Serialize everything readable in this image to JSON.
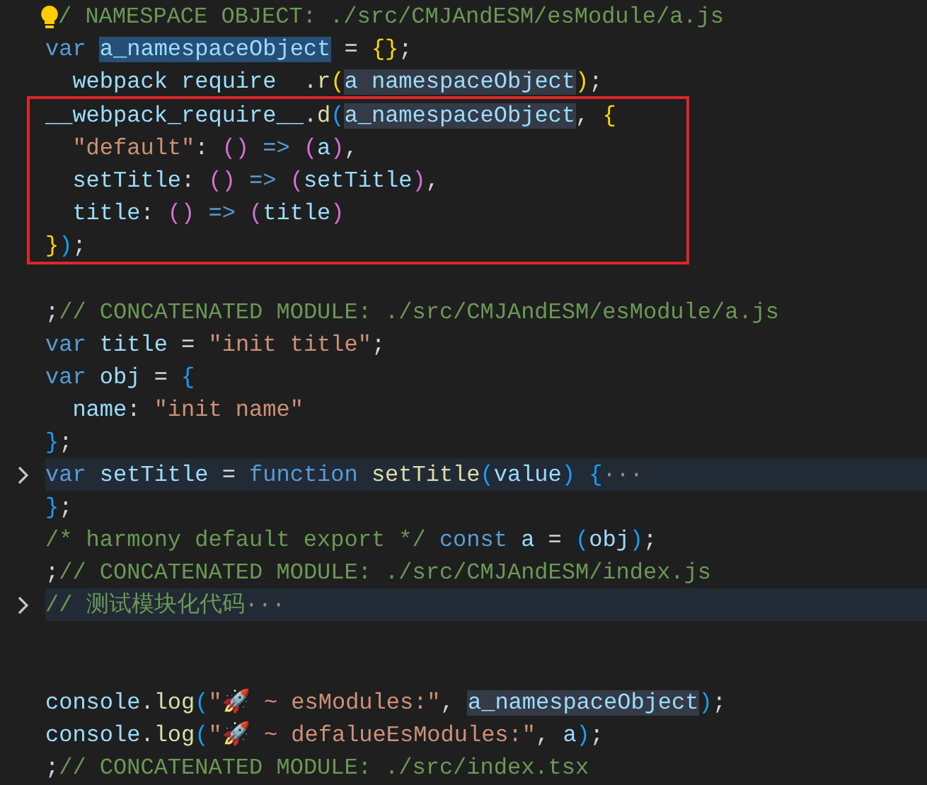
{
  "editor": {
    "lines": [
      {
        "lightbulb": true,
        "tokens": [
          {
            "kind": "comment",
            "text": "/ NAMESPACE OBJECT: ./src/CMJAndESM/esModule/a.js"
          }
        ]
      },
      {
        "tokens": [
          {
            "kind": "keyword",
            "text": "var "
          },
          {
            "kind": "selected",
            "text": "a_namespaceObject"
          },
          {
            "kind": "punct",
            "text": " = "
          },
          {
            "kind": "bracket1",
            "text": "{}"
          },
          {
            "kind": "punct",
            "text": ";"
          }
        ]
      },
      {
        "tokens": [
          {
            "kind": "variable",
            "text": "  webpack require  "
          },
          {
            "kind": "punct",
            "text": "."
          },
          {
            "kind": "function",
            "text": "r"
          },
          {
            "kind": "bracket1",
            "text": "("
          },
          {
            "kind": "reference",
            "text": "a namespaceObject"
          },
          {
            "kind": "bracket1",
            "text": ")"
          },
          {
            "kind": "punct",
            "text": ";"
          }
        ]
      },
      {
        "boxed": true,
        "tokens": [
          {
            "kind": "variable",
            "text": "__webpack_require__"
          },
          {
            "kind": "punct",
            "text": "."
          },
          {
            "kind": "function",
            "text": "d"
          },
          {
            "kind": "bracket3",
            "text": "("
          },
          {
            "kind": "reference",
            "text": "a_namespaceObject"
          },
          {
            "kind": "punct",
            "text": ", "
          },
          {
            "kind": "bracket1",
            "text": "{"
          }
        ]
      },
      {
        "boxed": true,
        "tokens": [
          {
            "kind": "string",
            "text": "  \"default\""
          },
          {
            "kind": "punct",
            "text": ": "
          },
          {
            "kind": "bracket2",
            "text": "()"
          },
          {
            "kind": "keyword",
            "text": " => "
          },
          {
            "kind": "bracket2",
            "text": "("
          },
          {
            "kind": "variable",
            "text": "a"
          },
          {
            "kind": "bracket2",
            "text": ")"
          },
          {
            "kind": "punct",
            "text": ","
          }
        ]
      },
      {
        "boxed": true,
        "tokens": [
          {
            "kind": "variable",
            "text": "  setTitle"
          },
          {
            "kind": "punct",
            "text": ": "
          },
          {
            "kind": "bracket2",
            "text": "()"
          },
          {
            "kind": "keyword",
            "text": " => "
          },
          {
            "kind": "bracket2",
            "text": "("
          },
          {
            "kind": "variable",
            "text": "setTitle"
          },
          {
            "kind": "bracket2",
            "text": ")"
          },
          {
            "kind": "punct",
            "text": ","
          }
        ]
      },
      {
        "boxed": true,
        "tokens": [
          {
            "kind": "variable",
            "text": "  title"
          },
          {
            "kind": "punct",
            "text": ": "
          },
          {
            "kind": "bracket2",
            "text": "()"
          },
          {
            "kind": "keyword",
            "text": " => "
          },
          {
            "kind": "bracket2",
            "text": "("
          },
          {
            "kind": "variable",
            "text": "title"
          },
          {
            "kind": "bracket2",
            "text": ")"
          }
        ]
      },
      {
        "boxed": true,
        "tokens": [
          {
            "kind": "bracket1",
            "text": "}"
          },
          {
            "kind": "bracket3",
            "text": ")"
          },
          {
            "kind": "punct",
            "text": ";"
          }
        ]
      },
      {
        "kind": "blank"
      },
      {
        "tokens": [
          {
            "kind": "punct",
            "text": ";"
          },
          {
            "kind": "comment",
            "text": "// CONCATENATED MODULE: ./src/CMJAndESM/esModule/a.js"
          }
        ]
      },
      {
        "tokens": [
          {
            "kind": "keyword",
            "text": "var "
          },
          {
            "kind": "variable",
            "text": "title"
          },
          {
            "kind": "punct",
            "text": " = "
          },
          {
            "kind": "string",
            "text": "\"init title\""
          },
          {
            "kind": "punct",
            "text": ";"
          }
        ]
      },
      {
        "tokens": [
          {
            "kind": "keyword",
            "text": "var "
          },
          {
            "kind": "variable",
            "text": "obj"
          },
          {
            "kind": "punct",
            "text": " = "
          },
          {
            "kind": "bracket3",
            "text": "{"
          }
        ]
      },
      {
        "tokens": [
          {
            "kind": "variable",
            "text": "  name"
          },
          {
            "kind": "punct",
            "text": ": "
          },
          {
            "kind": "string",
            "text": "\"init name\""
          }
        ]
      },
      {
        "tokens": [
          {
            "kind": "bracket3",
            "text": "}"
          },
          {
            "kind": "punct",
            "text": ";"
          }
        ]
      },
      {
        "folded": true,
        "tokens": [
          {
            "kind": "keyword",
            "text": "var "
          },
          {
            "kind": "variable",
            "text": "setTitle"
          },
          {
            "kind": "punct",
            "text": " = "
          },
          {
            "kind": "keyword",
            "text": "function "
          },
          {
            "kind": "function",
            "text": "setTitle"
          },
          {
            "kind": "bracket3",
            "text": "("
          },
          {
            "kind": "variable",
            "text": "value"
          },
          {
            "kind": "bracket3",
            "text": ") {"
          },
          {
            "kind": "ellipsis",
            "text": "···"
          }
        ]
      },
      {
        "tokens": [
          {
            "kind": "bracket3",
            "text": "}"
          },
          {
            "kind": "punct",
            "text": ";"
          }
        ]
      },
      {
        "tokens": [
          {
            "kind": "comment",
            "text": "/* harmony default export */ "
          },
          {
            "kind": "keyword",
            "text": "const "
          },
          {
            "kind": "variable",
            "text": "a"
          },
          {
            "kind": "punct",
            "text": " = "
          },
          {
            "kind": "bracket3",
            "text": "("
          },
          {
            "kind": "variable",
            "text": "obj"
          },
          {
            "kind": "bracket3",
            "text": ")"
          },
          {
            "kind": "punct",
            "text": ";"
          }
        ]
      },
      {
        "tokens": [
          {
            "kind": "punct",
            "text": ";"
          },
          {
            "kind": "comment",
            "text": "// CONCATENATED MODULE: ./src/CMJAndESM/index.js"
          }
        ]
      },
      {
        "folded": true,
        "tokens": [
          {
            "kind": "comment",
            "text": "// 测试模块化代码"
          },
          {
            "kind": "ellipsis",
            "text": "···"
          }
        ]
      },
      {
        "kind": "blank"
      },
      {
        "kind": "blank"
      },
      {
        "tokens": [
          {
            "kind": "variable",
            "text": "console"
          },
          {
            "kind": "punct",
            "text": "."
          },
          {
            "kind": "function",
            "text": "log"
          },
          {
            "kind": "bracket3",
            "text": "("
          },
          {
            "kind": "string",
            "text": "\"🚀 ~ esModules:\""
          },
          {
            "kind": "punct",
            "text": ", "
          },
          {
            "kind": "reference",
            "text": "a_namespaceObject"
          },
          {
            "kind": "bracket3",
            "text": ")"
          },
          {
            "kind": "punct",
            "text": ";"
          }
        ]
      },
      {
        "tokens": [
          {
            "kind": "variable",
            "text": "console"
          },
          {
            "kind": "punct",
            "text": "."
          },
          {
            "kind": "function",
            "text": "log"
          },
          {
            "kind": "bracket3",
            "text": "("
          },
          {
            "kind": "string",
            "text": "\"🚀 ~ defalueEsModules:\""
          },
          {
            "kind": "punct",
            "text": ", "
          },
          {
            "kind": "variable",
            "text": "a"
          },
          {
            "kind": "bracket3",
            "text": ")"
          },
          {
            "kind": "punct",
            "text": ";"
          }
        ]
      },
      {
        "tokens": [
          {
            "kind": "punct",
            "text": ";"
          },
          {
            "kind": "comment",
            "text": "// CONCATENATED MODULE: ./src/index.tsx"
          }
        ]
      }
    ]
  }
}
